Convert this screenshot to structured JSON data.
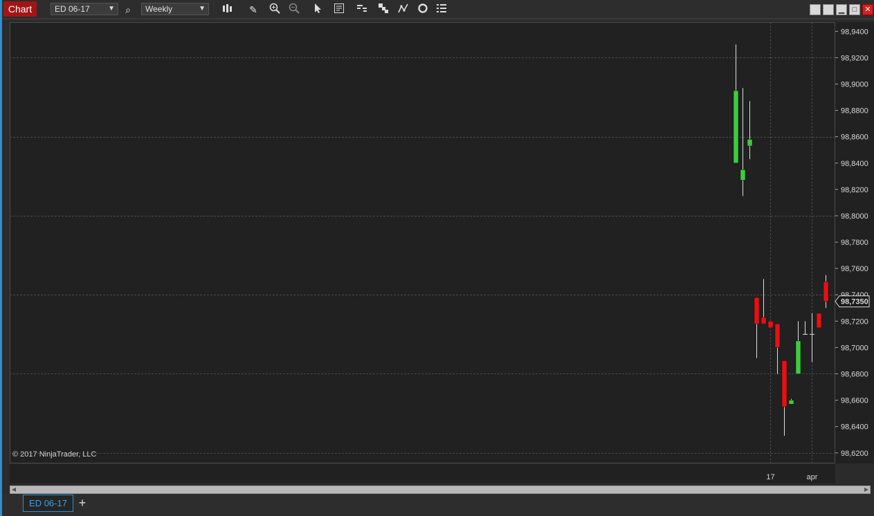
{
  "toolbar": {
    "chart_label": "Chart",
    "instrument": "ED 06-17",
    "interval": "Weekly",
    "tools": [
      "bar-type-icon",
      "pencil-icon",
      "zoom-in-icon",
      "zoom-out-icon",
      "pointer-icon",
      "data-box-icon",
      "indicators-icon",
      "strategies-icon",
      "drawing-tools-icon",
      "reload-icon",
      "properties-icon"
    ]
  },
  "window_controls": [
    "restore-icon",
    "restore-icon",
    "minimize-icon",
    "maximize-icon",
    "close-icon"
  ],
  "copyright": "© 2017 NinjaTrader, LLC",
  "tabs": {
    "active": "ED 06-17",
    "add": "+"
  },
  "colors": {
    "up": "#3dcc3d",
    "down": "#e81010",
    "background": "#212121",
    "grid": "#4a4a4a",
    "accent": "#a31515"
  },
  "chart_data": {
    "type": "candlestick",
    "instrument": "ED 06-17",
    "interval": "Weekly",
    "ylim": [
      98.612,
      98.947
    ],
    "yticks": [
      "98,9400",
      "98,9200",
      "98,9000",
      "98,8800",
      "98,8600",
      "98,8400",
      "98,8200",
      "98,8000",
      "98,7800",
      "98,7600",
      "98,7400",
      "98,7200",
      "98,7000",
      "98,6800",
      "98,6600",
      "98,6400",
      "98,6200"
    ],
    "ytick_values": [
      98.94,
      98.92,
      98.9,
      98.88,
      98.86,
      98.84,
      98.82,
      98.8,
      98.78,
      98.76,
      98.74,
      98.72,
      98.7,
      98.68,
      98.66,
      98.64,
      98.62
    ],
    "gridlines": [
      98.92,
      98.86,
      98.8,
      98.74,
      98.68,
      98.62
    ],
    "x_labels": [
      {
        "label": "17",
        "slot": 5
      },
      {
        "label": "apr",
        "slot": 11
      }
    ],
    "last_price": "98,7350",
    "last_price_value": 98.735,
    "candles": [
      {
        "open": 98.84,
        "high": 98.93,
        "low": 98.84,
        "close": 98.895
      },
      {
        "open": 98.827,
        "high": 98.897,
        "low": 98.815,
        "close": 98.835
      },
      {
        "open": 98.853,
        "high": 98.887,
        "low": 98.843,
        "close": 98.858
      },
      {
        "open": 98.738,
        "high": 98.738,
        "low": 98.692,
        "close": 98.718
      },
      {
        "open": 98.723,
        "high": 98.752,
        "low": 98.718,
        "close": 98.718
      },
      {
        "open": 98.72,
        "high": 98.72,
        "low": 98.715,
        "close": 98.715
      },
      {
        "open": 98.718,
        "high": 98.718,
        "low": 98.68,
        "close": 98.7
      },
      {
        "open": 98.69,
        "high": 98.69,
        "low": 98.633,
        "close": 98.655
      },
      {
        "open": 98.657,
        "high": 98.661,
        "low": 98.657,
        "close": 98.66
      },
      {
        "open": 98.68,
        "high": 98.72,
        "low": 98.68,
        "close": 98.705
      },
      {
        "open": 98.71,
        "high": 98.72,
        "low": 98.71,
        "close": 98.71
      },
      {
        "open": 98.71,
        "high": 98.726,
        "low": 98.689,
        "close": 98.71
      },
      {
        "open": 98.726,
        "high": 98.726,
        "low": 98.715,
        "close": 98.715
      },
      {
        "open": 98.75,
        "high": 98.755,
        "low": 98.73,
        "close": 98.735
      }
    ]
  }
}
